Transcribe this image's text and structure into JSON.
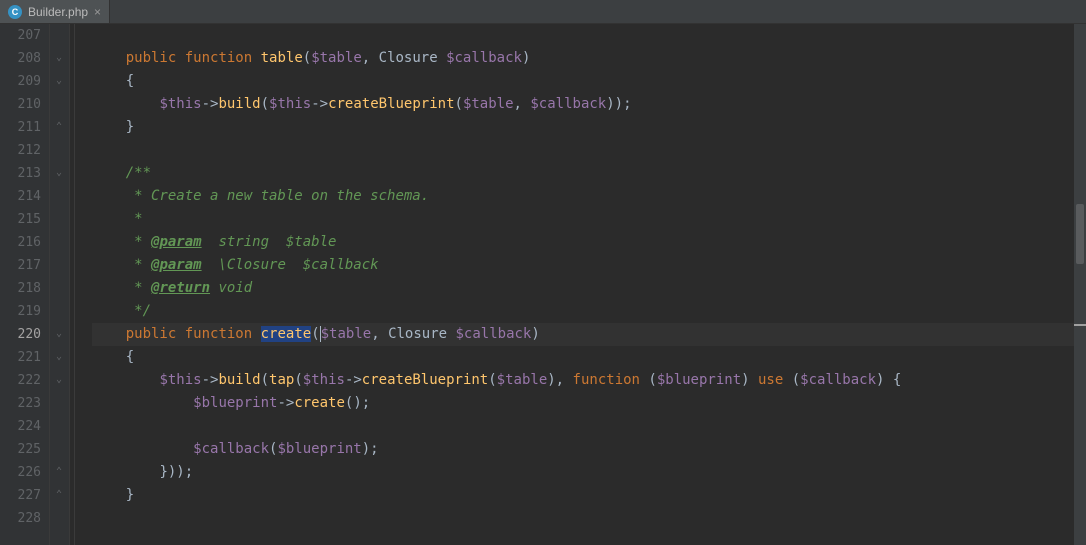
{
  "tab": {
    "filename": "Builder.php",
    "icon_letter": "C"
  },
  "editor": {
    "first_line": 207,
    "active_line": 220,
    "selection_text": "create",
    "lines": [
      {
        "n": 207,
        "indent": 1,
        "tokens": []
      },
      {
        "n": 208,
        "indent": 1,
        "tokens": [
          {
            "t": "kw",
            "v": "public"
          },
          {
            "t": "sp",
            "v": " "
          },
          {
            "t": "kw",
            "v": "function"
          },
          {
            "t": "sp",
            "v": " "
          },
          {
            "t": "fn",
            "v": "table"
          },
          {
            "t": "punct",
            "v": "("
          },
          {
            "t": "var",
            "v": "$table"
          },
          {
            "t": "punct",
            "v": ", "
          },
          {
            "t": "type",
            "v": "Closure "
          },
          {
            "t": "var",
            "v": "$callback"
          },
          {
            "t": "punct",
            "v": ")"
          }
        ]
      },
      {
        "n": 209,
        "indent": 1,
        "tokens": [
          {
            "t": "punct",
            "v": "{"
          }
        ]
      },
      {
        "n": 210,
        "indent": 2,
        "tokens": [
          {
            "t": "var",
            "v": "$this"
          },
          {
            "t": "arrow",
            "v": "->"
          },
          {
            "t": "fn",
            "v": "build"
          },
          {
            "t": "punct",
            "v": "("
          },
          {
            "t": "var",
            "v": "$this"
          },
          {
            "t": "arrow",
            "v": "->"
          },
          {
            "t": "fn",
            "v": "createBlueprint"
          },
          {
            "t": "punct",
            "v": "("
          },
          {
            "t": "var",
            "v": "$table"
          },
          {
            "t": "punct",
            "v": ", "
          },
          {
            "t": "var",
            "v": "$callback"
          },
          {
            "t": "punct",
            "v": "));"
          }
        ]
      },
      {
        "n": 211,
        "indent": 1,
        "tokens": [
          {
            "t": "punct",
            "v": "}"
          }
        ]
      },
      {
        "n": 212,
        "indent": 0,
        "tokens": []
      },
      {
        "n": 213,
        "indent": 1,
        "tokens": [
          {
            "t": "comment",
            "v": "/**"
          }
        ]
      },
      {
        "n": 214,
        "indent": 1,
        "tokens": [
          {
            "t": "comment",
            "v": " * Create a new table on the schema."
          }
        ]
      },
      {
        "n": 215,
        "indent": 1,
        "tokens": [
          {
            "t": "comment",
            "v": " *"
          }
        ]
      },
      {
        "n": 216,
        "indent": 1,
        "tokens": [
          {
            "t": "comment",
            "v": " * "
          },
          {
            "t": "tag",
            "v": "@param"
          },
          {
            "t": "comment",
            "v": "  string  $table"
          }
        ]
      },
      {
        "n": 217,
        "indent": 1,
        "tokens": [
          {
            "t": "comment",
            "v": " * "
          },
          {
            "t": "tag",
            "v": "@param"
          },
          {
            "t": "comment",
            "v": "  \\Closure  $callback"
          }
        ]
      },
      {
        "n": 218,
        "indent": 1,
        "tokens": [
          {
            "t": "comment",
            "v": " * "
          },
          {
            "t": "tag",
            "v": "@return"
          },
          {
            "t": "comment",
            "v": " void"
          }
        ]
      },
      {
        "n": 219,
        "indent": 1,
        "tokens": [
          {
            "t": "comment",
            "v": " */"
          }
        ]
      },
      {
        "n": 220,
        "indent": 1,
        "tokens": [
          {
            "t": "kw",
            "v": "public"
          },
          {
            "t": "sp",
            "v": " "
          },
          {
            "t": "kw",
            "v": "function"
          },
          {
            "t": "sp",
            "v": " "
          },
          {
            "t": "fn sel",
            "v": "create"
          },
          {
            "t": "punct",
            "v": "("
          },
          {
            "t": "var caret",
            "v": "$table"
          },
          {
            "t": "punct",
            "v": ", "
          },
          {
            "t": "type",
            "v": "Closure "
          },
          {
            "t": "var",
            "v": "$callback"
          },
          {
            "t": "punct",
            "v": ")"
          }
        ]
      },
      {
        "n": 221,
        "indent": 1,
        "tokens": [
          {
            "t": "punct",
            "v": "{"
          }
        ]
      },
      {
        "n": 222,
        "indent": 2,
        "tokens": [
          {
            "t": "var",
            "v": "$this"
          },
          {
            "t": "arrow",
            "v": "->"
          },
          {
            "t": "fn",
            "v": "build"
          },
          {
            "t": "punct",
            "v": "("
          },
          {
            "t": "fn",
            "v": "tap"
          },
          {
            "t": "punct",
            "v": "("
          },
          {
            "t": "var",
            "v": "$this"
          },
          {
            "t": "arrow",
            "v": "->"
          },
          {
            "t": "fn",
            "v": "createBlueprint"
          },
          {
            "t": "punct",
            "v": "("
          },
          {
            "t": "var",
            "v": "$table"
          },
          {
            "t": "punct",
            "v": "), "
          },
          {
            "t": "kw",
            "v": "function"
          },
          {
            "t": "punct",
            "v": " ("
          },
          {
            "t": "var",
            "v": "$blueprint"
          },
          {
            "t": "punct",
            "v": ") "
          },
          {
            "t": "kw",
            "v": "use"
          },
          {
            "t": "punct",
            "v": " ("
          },
          {
            "t": "var",
            "v": "$callback"
          },
          {
            "t": "punct",
            "v": ") {"
          }
        ]
      },
      {
        "n": 223,
        "indent": 3,
        "tokens": [
          {
            "t": "var",
            "v": "$blueprint"
          },
          {
            "t": "arrow",
            "v": "->"
          },
          {
            "t": "fn",
            "v": "create"
          },
          {
            "t": "punct",
            "v": "();"
          }
        ]
      },
      {
        "n": 224,
        "indent": 0,
        "tokens": []
      },
      {
        "n": 225,
        "indent": 3,
        "tokens": [
          {
            "t": "var",
            "v": "$callback"
          },
          {
            "t": "punct",
            "v": "("
          },
          {
            "t": "var",
            "v": "$blueprint"
          },
          {
            "t": "punct",
            "v": ");"
          }
        ]
      },
      {
        "n": 226,
        "indent": 2,
        "tokens": [
          {
            "t": "punct",
            "v": "}));"
          }
        ]
      },
      {
        "n": 227,
        "indent": 1,
        "tokens": [
          {
            "t": "punct",
            "v": "}"
          }
        ]
      },
      {
        "n": 228,
        "indent": 0,
        "tokens": []
      }
    ],
    "fold_marks": [
      {
        "line": 208,
        "kind": "down"
      },
      {
        "line": 209,
        "kind": "down"
      },
      {
        "line": 211,
        "kind": "up"
      },
      {
        "line": 213,
        "kind": "down"
      },
      {
        "line": 220,
        "kind": "down"
      },
      {
        "line": 221,
        "kind": "down"
      },
      {
        "line": 222,
        "kind": "down"
      },
      {
        "line": 226,
        "kind": "up"
      },
      {
        "line": 227,
        "kind": "up"
      }
    ]
  }
}
